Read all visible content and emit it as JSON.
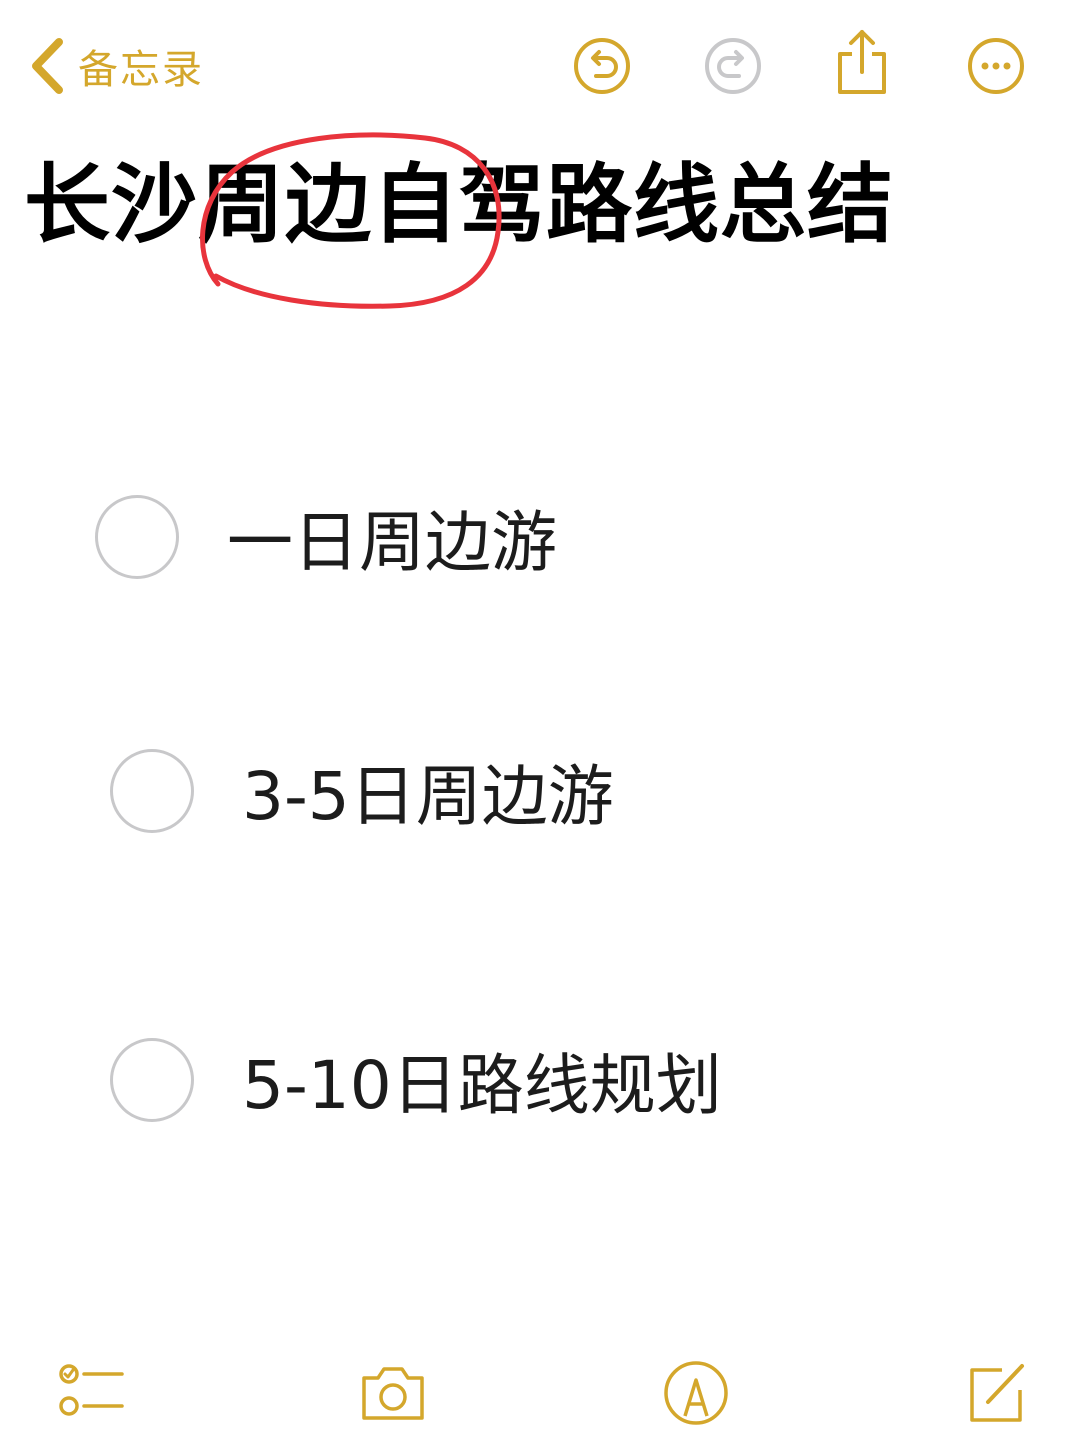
{
  "nav": {
    "back_label": "备忘录"
  },
  "toolbar": {
    "icons": [
      "undo-icon",
      "redo-icon",
      "share-icon",
      "more-icon"
    ]
  },
  "note": {
    "title": "长沙周边自驾路线总结",
    "checklist": [
      {
        "label": "一日周边游",
        "checked": false
      },
      {
        "label": "3-5日周边游",
        "checked": false
      },
      {
        "label": "5-10日路线规划",
        "checked": false
      }
    ]
  },
  "bottom_toolbar": {
    "icons": [
      "checklist-icon",
      "camera-icon",
      "markup-icon",
      "compose-icon"
    ]
  },
  "colors": {
    "accent": "#D4A72C",
    "disabled": "#C8C8CA",
    "annotation": "#E8343C",
    "text": "#000000"
  }
}
